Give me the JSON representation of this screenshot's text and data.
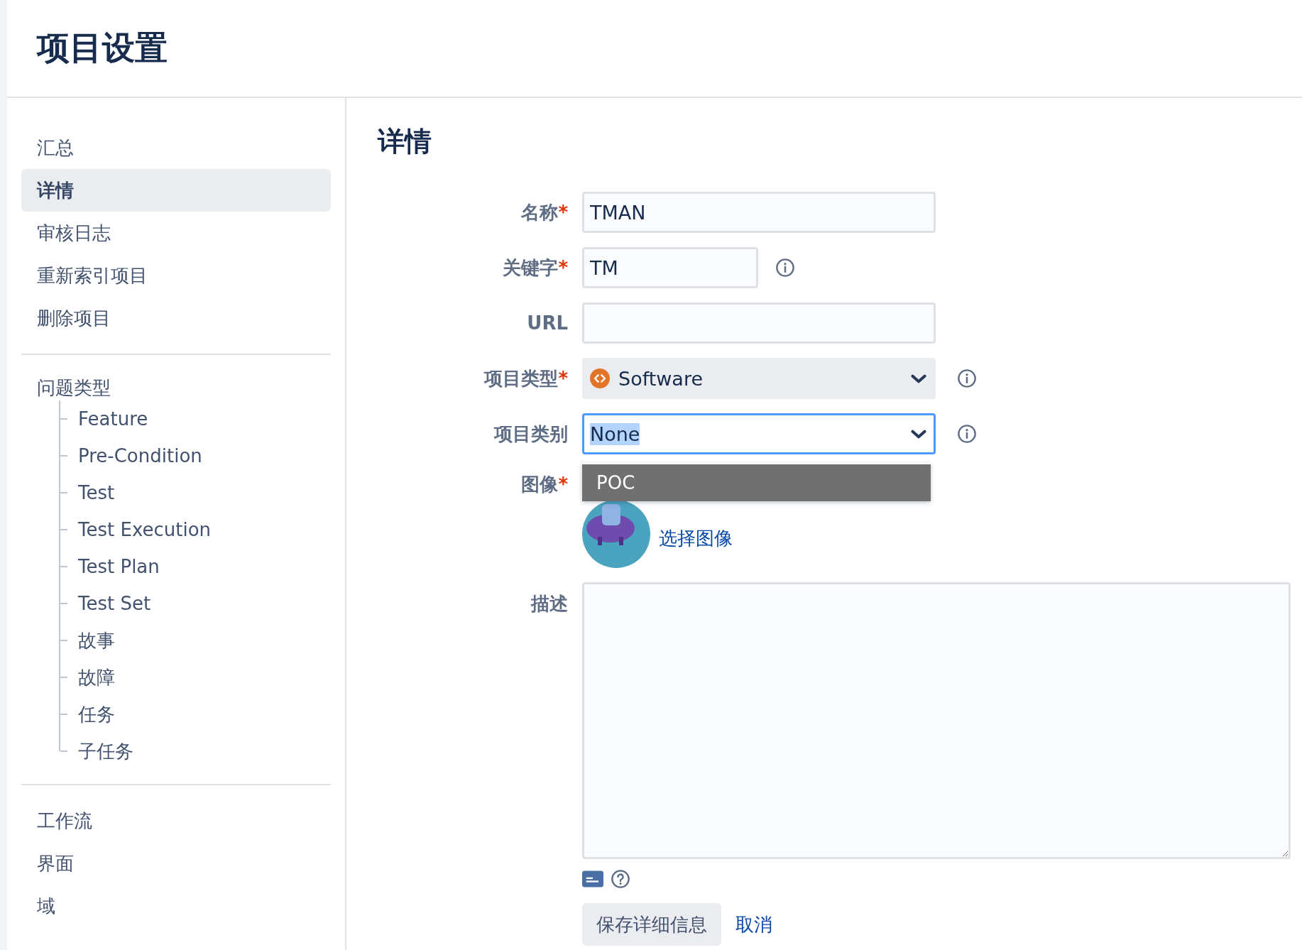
{
  "page_title": "项目设置",
  "sidebar": {
    "groups": [
      {
        "items": [
          {
            "label": "汇总",
            "selected": false
          },
          {
            "label": "详情",
            "selected": true
          },
          {
            "label": "审核日志",
            "selected": false
          },
          {
            "label": "重新索引项目",
            "selected": false
          },
          {
            "label": "删除项目",
            "selected": false
          }
        ]
      },
      {
        "items": [
          {
            "label": "问题类型",
            "selected": false,
            "children": [
              {
                "label": "Feature",
                "selected": false
              },
              {
                "label": "Pre-Condition",
                "selected": false
              },
              {
                "label": "Test",
                "selected": false
              },
              {
                "label": "Test Execution",
                "selected": false
              },
              {
                "label": "Test Plan",
                "selected": false
              },
              {
                "label": "Test Set",
                "selected": false
              },
              {
                "label": "故事",
                "selected": false
              },
              {
                "label": "故障",
                "selected": false
              },
              {
                "label": "任务",
                "selected": false
              },
              {
                "label": "子任务",
                "selected": false
              }
            ]
          }
        ]
      },
      {
        "items": [
          {
            "label": "工作流",
            "selected": false
          },
          {
            "label": "界面",
            "selected": false
          },
          {
            "label": "域",
            "selected": false
          }
        ]
      }
    ]
  },
  "main": {
    "heading": "详情",
    "fields": [
      {
        "kind": "text",
        "label": "名称",
        "required_mark": "*",
        "value": "TMAN"
      },
      {
        "kind": "short",
        "label": "关键字",
        "required_mark": "*",
        "value": "TM",
        "info": true
      },
      {
        "kind": "text",
        "label": "URL"
      },
      {
        "kind": "select",
        "label": "项目类型",
        "required_mark": "*",
        "value": "Software",
        "icon": true,
        "info": true
      },
      {
        "kind": "select",
        "label": "项目类别",
        "value": "None",
        "focused": true,
        "text_selected": true,
        "info": true,
        "options": [
          {
            "label": "POC",
            "selected": true
          }
        ]
      },
      {
        "kind": "avatar",
        "label": "图像",
        "required_mark": "*",
        "link": "选择图像"
      },
      {
        "kind": "textarea",
        "label": "描述"
      }
    ],
    "editor_tools": [
      {
        "kind": "wiki"
      },
      {
        "kind": "help"
      }
    ],
    "actions": [
      {
        "kind": "button",
        "label": "保存详细信息"
      },
      {
        "kind": "link",
        "label": "取消"
      }
    ]
  }
}
